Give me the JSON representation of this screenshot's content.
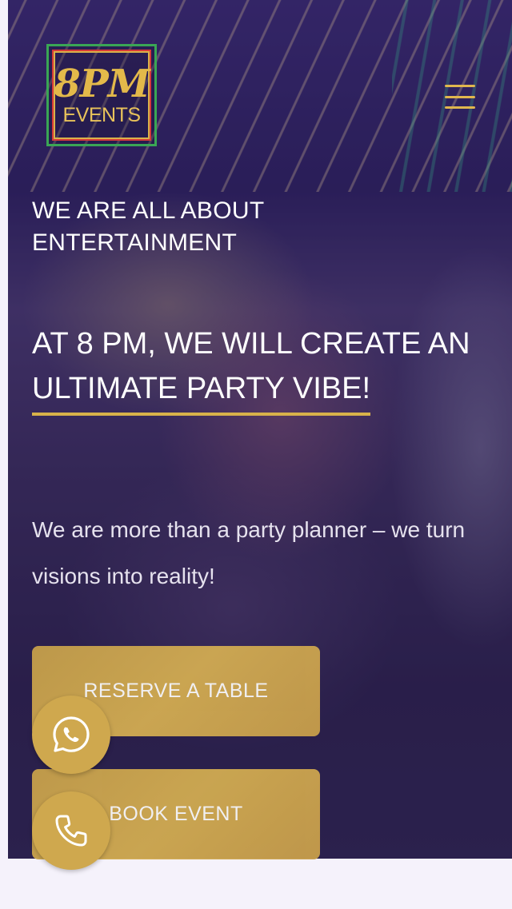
{
  "header": {
    "logo": {
      "main_text": "8PM",
      "sub_text": "EVENTS"
    },
    "menu_icon": "hamburger-menu-icon"
  },
  "hero": {
    "tagline": "WE ARE ALL ABOUT ENTERTAINMENT",
    "headline_part1": "AT 8 PM, WE WILL CREATE AN",
    "headline_highlight": "ULTIMATE PARTY VIBE!",
    "subtext": "We are more than a party planner – we turn visions into reality!",
    "buttons": {
      "reserve_label": "RESERVE A TABLE",
      "book_label": "BOOK EVENT"
    }
  },
  "floating_actions": {
    "whatsapp_icon": "whatsapp-icon",
    "phone_icon": "phone-icon"
  },
  "colors": {
    "accent_gold": "#d8b24a",
    "button_gold": "#cfa84e",
    "text_white": "#ffffff",
    "page_background": "#f5f2fb"
  }
}
